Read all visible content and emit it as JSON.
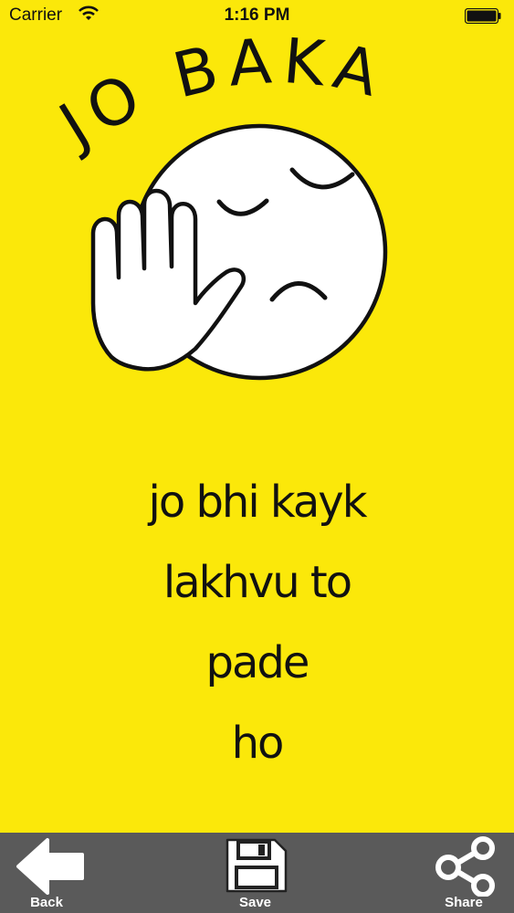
{
  "status_bar": {
    "carrier": "Carrier",
    "time": "1:16 PM"
  },
  "meme": {
    "title": "JO BAKA",
    "caption_lines": [
      "jo bhi kayk",
      "lakhvu to",
      "pade",
      "ho"
    ],
    "background": "#fbe80a"
  },
  "toolbar": {
    "back_label": "Back",
    "save_label": "Save",
    "share_label": "Share",
    "background": "#5a5a5a"
  }
}
